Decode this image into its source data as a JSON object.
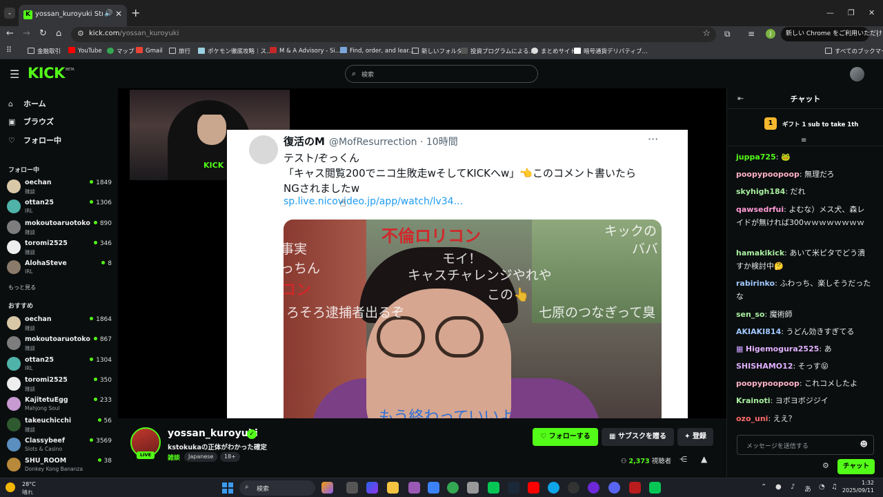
{
  "browser": {
    "tab_title": "yossan_kuroyuki Stream - W",
    "url_host": "kick.com",
    "url_path": "/yossan_kuroyuki",
    "chrome_promo": "新しい Chrome をご利用いただけます",
    "profile_initial": "J",
    "bookmarks": [
      "金融取引",
      "YouTube",
      "マップ",
      "Gmail",
      "旅行",
      "ポケモン徹底攻略｜ス...",
      "M & A Advisory - Si...",
      "Find, order, and lear...",
      "新しいフォルダ",
      "投資プログラムによる...",
      "まとめサイト",
      "暗号通貨デリバティブ..."
    ],
    "bookmarks_all": "すべてのブックマーク"
  },
  "kick": {
    "logo": "KICK",
    "beta": "BETA",
    "search_placeholder": "検索"
  },
  "sidebar": {
    "nav": [
      {
        "label": "ホーム",
        "icon": "home-icon"
      },
      {
        "label": "ブラウズ",
        "icon": "browse-icon"
      },
      {
        "label": "フォロー中",
        "icon": "heart-icon"
      }
    ],
    "following_title": "フォロー中",
    "following": [
      {
        "name": "oechan",
        "category": "雑談",
        "viewers": "1849",
        "color": "#d9c8a8"
      },
      {
        "name": "ottan25",
        "category": "IRL",
        "viewers": "1306",
        "color": "#4fb3a9"
      },
      {
        "name": "mokoutoaruotoko",
        "category": "雑談",
        "viewers": "890",
        "color": "#7d7d7d"
      },
      {
        "name": "toromi2525",
        "category": "雑談",
        "viewers": "346",
        "color": "#eeeeee"
      },
      {
        "name": "AlohaSteve",
        "category": "IRL",
        "viewers": "8",
        "color": "#8a7a6a"
      }
    ],
    "show_more": "もっと見る",
    "recommended_title": "おすすめ",
    "recommended": [
      {
        "name": "oechan",
        "category": "雑談",
        "viewers": "1864",
        "color": "#d9c8a8"
      },
      {
        "name": "mokoutoaruotoko",
        "category": "雑談",
        "viewers": "867",
        "color": "#7d7d7d"
      },
      {
        "name": "ottan25",
        "category": "IRL",
        "viewers": "1304",
        "color": "#4fb3a9"
      },
      {
        "name": "toromi2525",
        "category": "雑談",
        "viewers": "350",
        "color": "#eeeeee"
      },
      {
        "name": "KajitetuEgg",
        "category": "Mahjong Soul",
        "viewers": "233",
        "color": "#c79ad1"
      },
      {
        "name": "takeuchicchi",
        "category": "雑談",
        "viewers": "56",
        "color": "#2f5a2f"
      },
      {
        "name": "Classybeef",
        "category": "Slots & Casino",
        "viewers": "3569",
        "color": "#5a8fbf"
      },
      {
        "name": "SHU_ROOM",
        "category": "Donkey Kong Bananza",
        "viewers": "38",
        "color": "#b8893a"
      }
    ]
  },
  "player": {
    "cam_shirt_text": "KICK",
    "tweet": {
      "name": "復活のM",
      "handle": "@MofResurrection · 10時間",
      "line1": "テスト/ぞっくん",
      "line2": "「キャス閲覧200でニコ生敗走wそしてKICKへw」👈このコメント書いたら",
      "line3": "NGされましたw",
      "link": "sp.live.nicovideo.jp/app/watch/lv34...",
      "overlays": {
        "red_title": "不倫ロリコン",
        "kick_text": "キックの",
        "baba": "ババ",
        "jijitsu": "事実",
        "chan": "っちん",
        "moi": "モイ！",
        "challenge": "キャスチャレンジやれや",
        "kono": "この👆",
        "kon": "コン",
        "taiho": "ろそろ逮捕者出るぞ",
        "nanahara": "七原のつなぎって臭",
        "bottom": "もう終わっていいよ"
      }
    }
  },
  "stream": {
    "streamer": "yossan_kuroyuki",
    "live": "LIVE",
    "title": "kstokukaの正体がわかった確定",
    "category": "雑談",
    "tags": [
      "Japanese",
      "18+"
    ],
    "follow": "フォローする",
    "gift": "サブスクを贈る",
    "subscribe": "登録",
    "viewers": "2,373",
    "viewers_label": "視聴者"
  },
  "chat": {
    "title": "チャット",
    "gift_rank": "1",
    "gift_text": "ギフト 1 sub to take 1th",
    "messages": [
      {
        "user": "juppa725",
        "text": "🐸",
        "color": "#53fc18"
      },
      {
        "user": "poopypoopoop",
        "text": "無理だろ",
        "color": "#ffb3c7"
      },
      {
        "user": "skyhigh184",
        "text": "だれ",
        "color": "#a8f0a0"
      },
      {
        "user": "qawsedrfui",
        "text": "よむな）メス犬、森レイドが無ければ300ｗｗｗｗｗｗｗｗ",
        "color": "#ff9ad5"
      },
      {
        "user": "hamakikick",
        "text": "あいて米ピタでどう潰すか検討中🤔",
        "color": "#a8f0a0"
      },
      {
        "user": "rabirinko",
        "text": "ふわっち、楽しそうだったな",
        "color": "#a0c8ff"
      },
      {
        "user": "sen_so",
        "text": "魔術師",
        "color": "#a8f0a0"
      },
      {
        "user": "AKIAKI814",
        "text": "うどん効きすぎてる",
        "color": "#a0c8ff"
      },
      {
        "user": "Higemogura2525",
        "text": "あ",
        "color": "#e0b0ff",
        "badge": true
      },
      {
        "user": "SHISHAMO12",
        "text": "そっす😝",
        "color": "#e0b0ff"
      },
      {
        "user": "poopypoopoop",
        "text": "これコメしたよ",
        "color": "#ffb3c7"
      },
      {
        "user": "Krainoti",
        "text": "ヨボヨボジジイ",
        "color": "#a8f0a0"
      },
      {
        "user": "ozo_uni",
        "text": "ええ？",
        "color": "#ff6b6b"
      }
    ],
    "input_placeholder": "メッセージを送信する",
    "send": "チャット"
  },
  "taskbar": {
    "temp": "28°C",
    "weather": "晴れ",
    "search": "検索",
    "ime": "あ",
    "time": "1:32",
    "date": "2025/09/11"
  }
}
